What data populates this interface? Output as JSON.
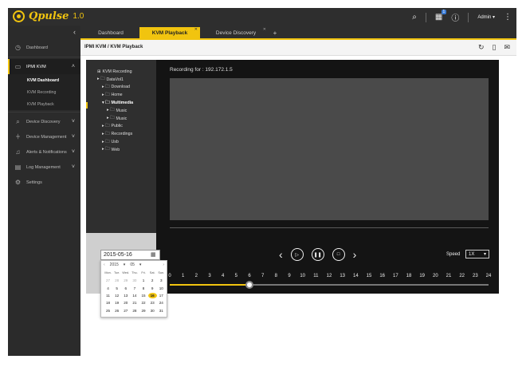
{
  "app": {
    "name": "Qpulse",
    "version": "1.0"
  },
  "header": {
    "user_menu": "Admin ▾",
    "notification_count": "1"
  },
  "sidebar": {
    "items": [
      {
        "label": "Dashboard"
      },
      {
        "label": "IPMI KVM"
      },
      {
        "label": "Device Discovery"
      },
      {
        "label": "Device Management"
      },
      {
        "label": "Alerts & Notifications"
      },
      {
        "label": "Log Management"
      },
      {
        "label": "Settings"
      }
    ],
    "sub_items": [
      {
        "label": "KVM Dashboard"
      },
      {
        "label": "KVM Recording"
      },
      {
        "label": "KVM Playback"
      }
    ]
  },
  "tabs": [
    {
      "label": "Dashboard"
    },
    {
      "label": "KVM Playback"
    },
    {
      "label": "Device Discovery"
    }
  ],
  "breadcrumb": "IPMI KVM / KVM Playback",
  "tree": [
    "KVM Recording",
    "DataVol1",
    "Download",
    "Home",
    "Multimedia",
    "Music",
    "Music",
    "Public",
    "Recordings",
    "Usb",
    "Web"
  ],
  "player": {
    "recording_label": "Recording for : 192.172.1.5",
    "speed_label": "Speed",
    "speed_value": "1X",
    "position_fraction": 0.25
  },
  "timeline": [
    "0",
    "1",
    "2",
    "3",
    "4",
    "5",
    "6",
    "7",
    "8",
    "9",
    "10",
    "11",
    "12",
    "13",
    "14",
    "15",
    "16",
    "17",
    "18",
    "19",
    "20",
    "21",
    "22",
    "23",
    "24"
  ],
  "date": {
    "value": "2015-05-16",
    "year": "2015",
    "month": "05",
    "weekdays": [
      "Mon.",
      "Tue.",
      "Wed.",
      "Thu.",
      "Fri.",
      "Sat.",
      "Sun."
    ],
    "weeks": [
      [
        "27",
        "28",
        "29",
        "30",
        "1",
        "2",
        "3"
      ],
      [
        "4",
        "5",
        "6",
        "7",
        "8",
        "9",
        "10"
      ],
      [
        "11",
        "12",
        "13",
        "14",
        "15",
        "16",
        "17"
      ],
      [
        "18",
        "19",
        "20",
        "21",
        "22",
        "23",
        "24"
      ],
      [
        "25",
        "26",
        "27",
        "28",
        "29",
        "30",
        "31"
      ]
    ],
    "selected": "16"
  },
  "colors": {
    "accent": "#f1c40f"
  }
}
